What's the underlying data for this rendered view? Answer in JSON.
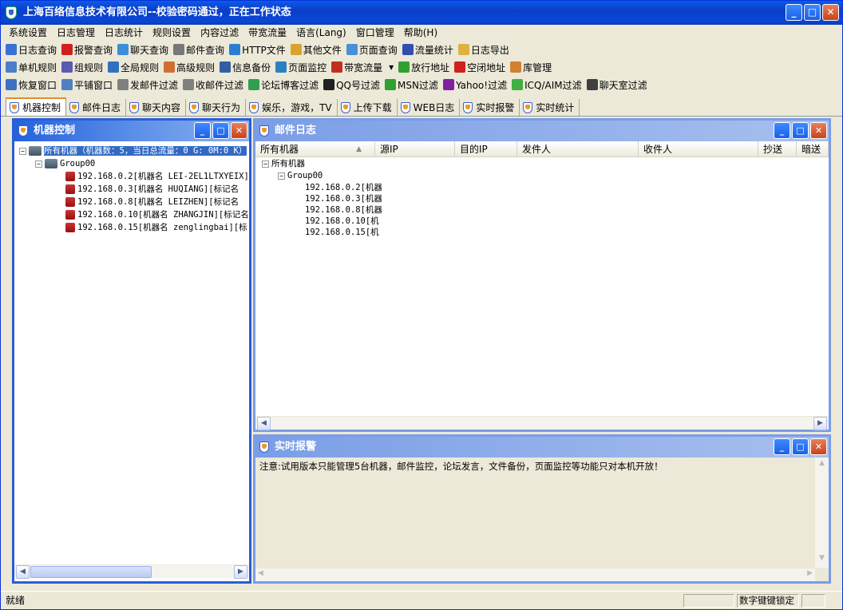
{
  "app": {
    "title": "上海百络信息技术有限公司--校验密码通过，正在工作状态"
  },
  "menu": [
    "系统设置",
    "日志管理",
    "日志统计",
    "规则设置",
    "内容过滤",
    "带宽流量",
    "语言(Lang)",
    "窗口管理",
    "帮助(H)"
  ],
  "toolbar1": [
    {
      "label": "日志查询",
      "icon": "log-search-icon",
      "color": "#3a6fd8"
    },
    {
      "label": "报警查询",
      "icon": "alert-icon",
      "color": "#d02020"
    },
    {
      "label": "聊天查询",
      "icon": "chat-icon",
      "color": "#3a8fd8"
    },
    {
      "label": "邮件查询",
      "icon": "mail-icon",
      "color": "#777777"
    },
    {
      "label": "HTTP文件",
      "icon": "http-icon",
      "color": "#2a7fd0"
    },
    {
      "label": "其他文件",
      "icon": "folder-icon",
      "color": "#d8a430"
    },
    {
      "label": "页面查询",
      "icon": "page-icon",
      "color": "#4a8fd8"
    },
    {
      "label": "流量统计",
      "icon": "chart-icon",
      "color": "#3050b0"
    },
    {
      "label": "日志导出",
      "icon": "export-icon",
      "color": "#e0b040"
    }
  ],
  "toolbar2": [
    {
      "label": "单机规则",
      "icon": "single-rule-icon",
      "color": "#4a7fc8"
    },
    {
      "label": "组规则",
      "icon": "group-rule-icon",
      "color": "#5a5ab0"
    },
    {
      "label": "全局规则",
      "icon": "global-rule-icon",
      "color": "#3070c0"
    },
    {
      "label": "高级规则",
      "icon": "advanced-rule-icon",
      "color": "#d07030"
    },
    {
      "label": "信息备份",
      "icon": "backup-icon",
      "color": "#3060a0"
    },
    {
      "label": "页面监控",
      "icon": "page-monitor-icon",
      "color": "#2a80c0"
    },
    {
      "label": "带宽流量",
      "icon": "bandwidth-icon",
      "color": "#c03020"
    },
    {
      "label": "放行地址",
      "icon": "allow-icon",
      "color": "#30a030"
    },
    {
      "label": "空闭地址",
      "icon": "block-icon",
      "color": "#d02020"
    },
    {
      "label": "库管理",
      "icon": "library-icon",
      "color": "#d08030"
    }
  ],
  "toolbar3": [
    {
      "label": "恢复窗口",
      "icon": "restore-window-icon",
      "color": "#4070c0"
    },
    {
      "label": "平铺窗口",
      "icon": "tile-window-icon",
      "color": "#5080c0"
    },
    {
      "label": "发邮件过滤",
      "icon": "send-mail-filter-icon",
      "color": "#808080"
    },
    {
      "label": "收邮件过滤",
      "icon": "receive-mail-filter-icon",
      "color": "#808080"
    },
    {
      "label": "论坛博客过滤",
      "icon": "forum-filter-icon",
      "color": "#30a050"
    },
    {
      "label": "QQ号过滤",
      "icon": "qq-icon",
      "color": "#202020"
    },
    {
      "label": "MSN过滤",
      "icon": "msn-icon",
      "color": "#30a030"
    },
    {
      "label": "Yahoo!过滤",
      "icon": "yahoo-icon",
      "color": "#8020a0"
    },
    {
      "label": "ICQ/AIM过滤",
      "icon": "icq-icon",
      "color": "#40b040"
    },
    {
      "label": "聊天室过滤",
      "icon": "chatroom-icon",
      "color": "#404040"
    }
  ],
  "tabs": [
    "机器控制",
    "邮件日志",
    "聊天内容",
    "聊天行为",
    "娱乐，游戏，TV",
    "上传下载",
    "WEB日志",
    "实时报警",
    "实时统计"
  ],
  "machine_pane": {
    "title": "机器控制",
    "root": "所有机器（机器数：5，当日总流量：0 G: 0M:0 K）",
    "group": "Group00",
    "machines": [
      "192.168.0.2[机器名 LEI-2EL1LTXYEIX]",
      "192.168.0.3[机器名 HUQIANG][标记名",
      "192.168.0.8[机器名 LEIZHEN][标记名",
      "192.168.0.10[机器名 ZHANGJIN][标记名",
      "192.168.0.15[机器名 zenglingbai][标"
    ]
  },
  "mail_pane": {
    "title": "邮件日志",
    "columns": [
      "所有机器",
      "源IP",
      "目的IP",
      "发件人",
      "收件人",
      "抄送",
      "暗送"
    ],
    "root": "所有机器",
    "group": "Group00",
    "machines": [
      "192.168.0.2[机器",
      "192.168.0.3[机器",
      "192.168.0.8[机器",
      "192.168.0.10[机",
      "192.168.0.15[机"
    ]
  },
  "alert_pane": {
    "title": "实时报警",
    "message": "注意:试用版本只能管理5台机器，邮件监控，论坛发言，文件备份，页面监控等功能只对本机开放！"
  },
  "status": {
    "left": "就绪",
    "numlock": "数字键键锁定"
  }
}
